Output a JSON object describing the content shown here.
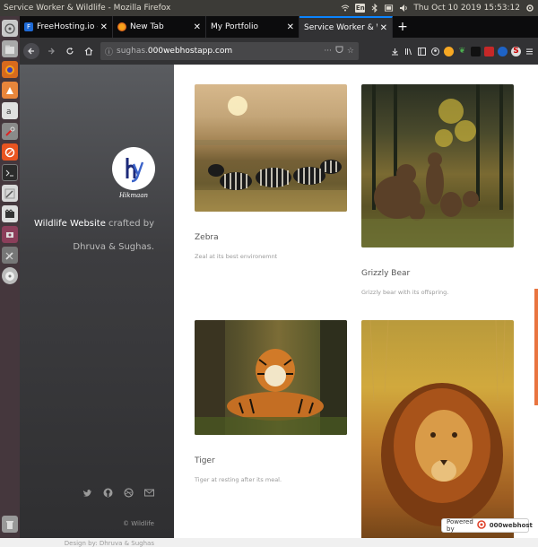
{
  "os": {
    "window_title": "Service Worker & Wildlife - Mozilla Firefox",
    "keyboard_lang": "En",
    "clock": "Thu Oct 10 2019 15:53:12"
  },
  "browser": {
    "tabs": [
      {
        "label": "FreeHosting.io - Website",
        "active": false
      },
      {
        "label": "New Tab",
        "active": false
      },
      {
        "label": "My Portfolio",
        "active": false
      },
      {
        "label": "Service Worker & Wildlife",
        "active": true
      }
    ],
    "url_host_prefix": "sughas.",
    "url_host_main": "000webhostapp.com"
  },
  "sidebar": {
    "logo_caption": "Hikmaan",
    "title_bright": "Wildlife Website",
    "title_rest": " crafted by",
    "subtitle": "Dhruva & Sughas.",
    "copyright": "© Wildlife",
    "design_by": "Design by: Dhruva & Sughas"
  },
  "cards": [
    {
      "title": "Zebra",
      "description": "Zeal at its best environemnt"
    },
    {
      "title": "Grizzly Bear",
      "description": "Grizzly bear with its offspring."
    },
    {
      "title": "Tiger",
      "description": "Tiger at resting after its meal."
    },
    {
      "title": "",
      "description": ""
    }
  ],
  "badge": {
    "prefix": "Powered by",
    "brand": "000webhost"
  },
  "colors": {
    "accent": "#0a84ff",
    "scroll_accent": "#e97540",
    "launcher_bg": "#45373d"
  }
}
